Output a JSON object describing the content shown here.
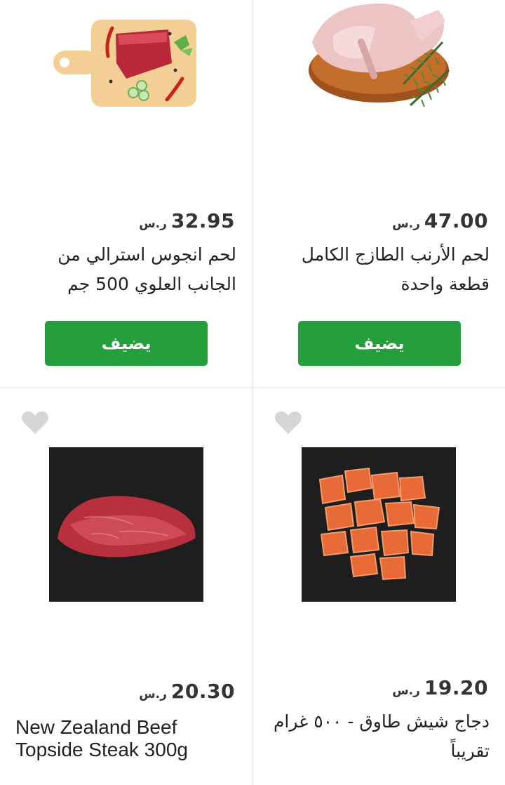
{
  "currency": "ر.س",
  "add_label": "يضيف",
  "products": [
    {
      "name_line1": "لحم انجوس استرالي من",
      "name_line2": "الجانب العلوي 500 جم",
      "price": "32.95",
      "image_icon": "beef-on-cutting-board-image"
    },
    {
      "name_line1": "لحم الأرنب الطازج الكامل",
      "name_line2": "قطعة واحدة",
      "price": "47.00",
      "image_icon": "whole-rabbit-on-board-image"
    },
    {
      "name_line1": "New Zealand Beef",
      "name_line2": "Topside Steak 300g",
      "price": "20.30",
      "image_icon": "beef-steak-image"
    },
    {
      "name_line1": "دجاج شيش طاوق - ٥٠٠ غرام",
      "name_line2": "تقريباً",
      "price": "19.20",
      "image_icon": "chicken-shish-tawook-image"
    }
  ],
  "colors": {
    "add_button": "#259e3c",
    "background": "#ededed",
    "heart": "#d6d6d6"
  }
}
